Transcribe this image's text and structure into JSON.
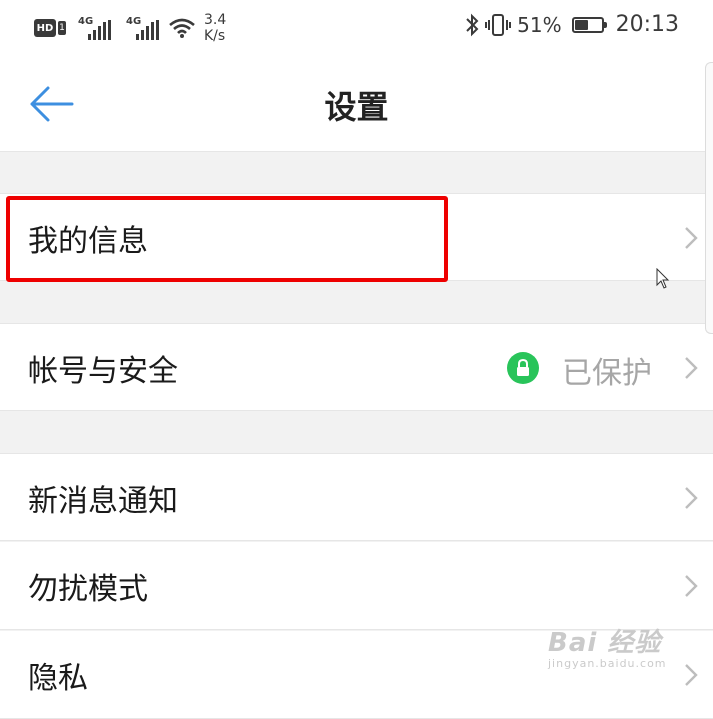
{
  "status_bar": {
    "hd_label": "HD",
    "hd_sim": "1",
    "signal_1_label": "4G",
    "signal_2_label": "4G",
    "net_speed_value": "3.4",
    "net_speed_unit": "K/s",
    "battery_percent": "51%",
    "battery_level": 0.51,
    "time": "20:13"
  },
  "header": {
    "title": "设置",
    "back_icon": "arrow-left-icon",
    "accent_color": "#3d8fe0"
  },
  "settings": {
    "items": [
      {
        "label": "我的信息"
      },
      {
        "label": "帐号与安全",
        "status": "已保护",
        "status_icon": "lock-icon",
        "status_icon_color": "#29c45a"
      },
      {
        "label": "新消息通知"
      },
      {
        "label": "勿扰模式"
      },
      {
        "label": "隐私"
      }
    ]
  },
  "highlight": {
    "color": "#ee0000"
  },
  "watermark": {
    "brand": "Bai  经验",
    "url": "jingyan.baidu.com"
  }
}
